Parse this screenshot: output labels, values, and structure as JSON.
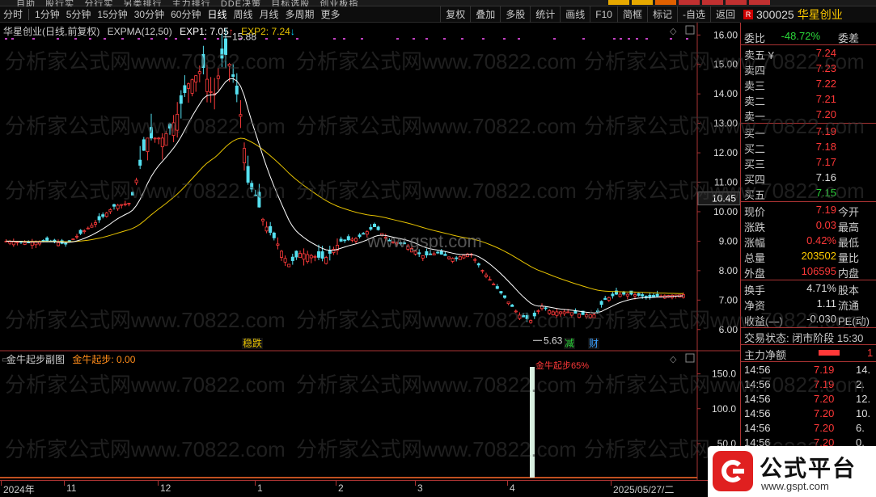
{
  "nav_text": "自助   股行实   分行实   另类排行   主力排行   DDE决策   目标选股   创业板指",
  "toolbar": {
    "periods": [
      "分时",
      "1分钟",
      "5分钟",
      "15分钟",
      "30分钟",
      "60分钟",
      "日线",
      "周线",
      "月线",
      "多周期",
      "更多"
    ],
    "active_period": "日线",
    "tools": [
      "复权",
      "叠加",
      "多股",
      "统计",
      "画线",
      "F10",
      "简框",
      "标记",
      "-自选",
      "返回"
    ]
  },
  "symbol": {
    "badge": "R",
    "code": "300025",
    "name": "华星创业"
  },
  "chart": {
    "title_prefix": "华星创业(日线,前复权)",
    "indicator": "EXPMA(12,50)",
    "exp1": "EXP1: 7.05",
    "exp1_arrow": "↑",
    "exp2": "EXP2: 7.24",
    "exp2_arrow": "↓",
    "price_ticks": [
      "16.00",
      "15.00",
      "14.00",
      "13.00",
      "12.00",
      "11.00",
      "10.00",
      "9.00",
      "8.00",
      "7.00",
      "6.00"
    ],
    "current_price_label": "10.45",
    "high_label": "15.88",
    "low_label": "5.63",
    "events": [
      "稳跌",
      "减",
      "财"
    ],
    "sub_title": "金牛起步副图",
    "sub_value_label": "金牛起步: 0.00",
    "sub_ticks": [
      "150.0",
      "100.0",
      "50.0"
    ],
    "sub_marker_text": "金牛起步65%",
    "x_labels": [
      "2024年",
      "11",
      "12",
      "1",
      "2",
      "3",
      "4",
      "2025/05/27/二"
    ]
  },
  "chart_data": {
    "type": "candlestick",
    "ylim": [
      5.5,
      16.2
    ],
    "series": [
      {
        "name": "EXP1",
        "value": 7.05
      },
      {
        "name": "EXP2",
        "value": 7.24
      }
    ],
    "high": 15.88,
    "low": 5.63,
    "sub_chart": {
      "ylim": [
        0,
        160
      ],
      "peak": 160
    }
  },
  "panel": {
    "weibi_label": "委比",
    "weibi_value": "-48.72%",
    "weicha_label": "委差",
    "asks": [
      {
        "label": "卖五 ¥",
        "price": "7.24"
      },
      {
        "label": "卖四",
        "price": "7.23"
      },
      {
        "label": "卖三",
        "price": "7.22"
      },
      {
        "label": "卖二",
        "price": "7.21"
      },
      {
        "label": "卖一",
        "price": "7.20"
      }
    ],
    "bids": [
      {
        "label": "买一",
        "price": "7.19"
      },
      {
        "label": "买二",
        "price": "7.18"
      },
      {
        "label": "买三",
        "price": "7.17"
      },
      {
        "label": "买四",
        "price": "7.16"
      },
      {
        "label": "买五",
        "price": "7.15"
      }
    ],
    "stats": [
      {
        "l": "现价",
        "v": "7.19",
        "l2": "今开",
        "c": "red"
      },
      {
        "l": "涨跌",
        "v": "0.03",
        "l2": "最高",
        "c": "red"
      },
      {
        "l": "涨幅",
        "v": "0.42%",
        "l2": "最低",
        "c": "red"
      },
      {
        "l": "总量",
        "v": "203502",
        "l2": "量比",
        "c": "yel"
      },
      {
        "l": "外盘",
        "v": "106595",
        "l2": "内盘",
        "c": "red"
      }
    ],
    "stats2": [
      {
        "l": "换手",
        "v": "4.71%",
        "l2": "股本",
        "c": "wht"
      },
      {
        "l": "净资",
        "v": "1.11",
        "l2": "流通",
        "c": "wht"
      },
      {
        "l": "收益(—)",
        "v": "-0.030",
        "l2": "PE(动)",
        "c": "wht"
      }
    ],
    "status_label": "交易状态: 闭市阶段 15:30",
    "flow_label": "主力净额",
    "flow_value": "1",
    "ticks": [
      {
        "t": "14:56",
        "p": "7.19",
        "v": "14."
      },
      {
        "t": "14:56",
        "p": "7.19",
        "v": "2."
      },
      {
        "t": "14:56",
        "p": "7.20",
        "v": "12."
      },
      {
        "t": "14:56",
        "p": "7.20",
        "v": "10."
      },
      {
        "t": "14:56",
        "p": "7.20",
        "v": "6."
      },
      {
        "t": "14:56",
        "p": "7.20",
        "v": "0."
      }
    ]
  },
  "watermark": "分析家公式网www.70822.com",
  "watermark2": "www.gspt.com",
  "logo": {
    "title": "公式平台",
    "url": "www.gspt.com"
  }
}
